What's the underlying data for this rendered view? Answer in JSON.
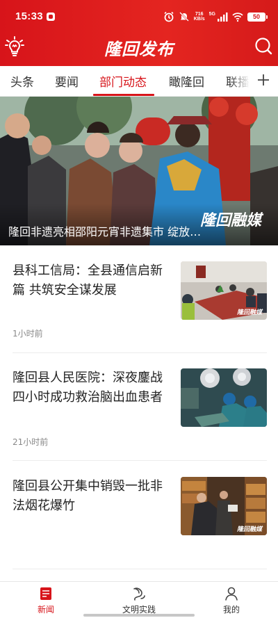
{
  "status_bar": {
    "time": "15:33",
    "speed_value": "716",
    "speed_unit": "KB/s",
    "network": "5G",
    "battery": "50"
  },
  "header": {
    "title": "隆回发布",
    "left_icon": "lightbulb-icon",
    "right_icon": "search-icon"
  },
  "tabs": [
    {
      "label": "头条"
    },
    {
      "label": "要闻"
    },
    {
      "label": "部门动态",
      "active": true
    },
    {
      "label": "瞰隆回"
    },
    {
      "label": "联播"
    }
  ],
  "hero": {
    "caption": "隆回非遗亮相邵阳元宵非遗集市 绽放…",
    "watermark": "隆回融媒"
  },
  "news": [
    {
      "title": "县科工信局：全县通信启新篇 共筑安全谋发展",
      "time": "1小时前",
      "thumb_watermark": "隆回融媒"
    },
    {
      "title": "隆回县人民医院：深夜鏖战四小时成功救治脑出血患者",
      "time": "21小时前",
      "thumb_watermark": ""
    },
    {
      "title": "隆回县公开集中销毁一批非法烟花爆竹",
      "time": "",
      "thumb_watermark": "隆回融媒"
    }
  ],
  "bottom_nav": [
    {
      "label": "新闻",
      "icon": "news-icon",
      "active": true
    },
    {
      "label": "文明实践",
      "icon": "civilization-icon"
    },
    {
      "label": "我的",
      "icon": "profile-icon"
    }
  ],
  "colors": {
    "brand_red": "#d7141a",
    "text": "#222222",
    "muted": "#888888"
  }
}
